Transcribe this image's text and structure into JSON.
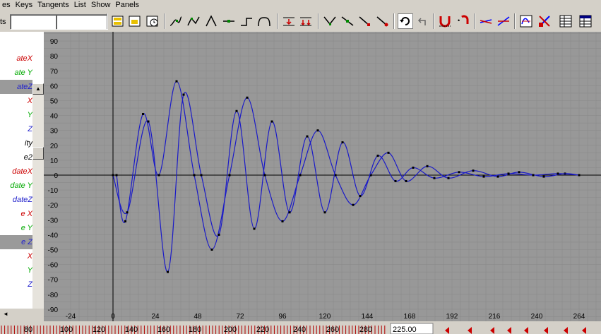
{
  "menu": [
    "es",
    "Keys",
    "Tangents",
    "List",
    "Show",
    "Panels"
  ],
  "toolbar": {
    "stats_label": "ts",
    "field1_value": "",
    "field2_value": "",
    "buttons": [
      {
        "name": "frame-all-button",
        "icon": "frame-all-icon"
      },
      {
        "name": "frame-selection-button",
        "icon": "frame-selection-icon"
      },
      {
        "name": "frame-playback-button",
        "icon": "clock-icon"
      },
      {
        "name": "spline-tangents-button",
        "icon": "spline-tangent-icon"
      },
      {
        "name": "clamped-tangents-button",
        "icon": "clamped-tangent-icon"
      },
      {
        "name": "linear-tangents-button",
        "icon": "linear-tangent-icon"
      },
      {
        "name": "flat-tangents-button",
        "icon": "flat-tangent-icon"
      },
      {
        "name": "step-tangents-button",
        "icon": "step-tangent-icon"
      },
      {
        "name": "plateau-tangents-button",
        "icon": "plateau-tangent-icon"
      },
      {
        "name": "buffer-curve-snapshot-button",
        "icon": "buffer-snapshot-icon"
      },
      {
        "name": "buffer-curve-swap-button",
        "icon": "buffer-swap-icon"
      },
      {
        "name": "break-tangents-button",
        "icon": "break-tangent-icon"
      },
      {
        "name": "unify-tangents-button",
        "icon": "unify-tangent-icon"
      },
      {
        "name": "free-tangent-weight-button",
        "icon": "free-weight-icon"
      },
      {
        "name": "lock-tangent-weight-button",
        "icon": "lock-weight-icon"
      },
      {
        "name": "pre-infinity-cycle-button",
        "icon": "cycle-icon"
      },
      {
        "name": "post-infinity-button",
        "icon": "undo-arrow-icon"
      },
      {
        "name": "auto-load-button",
        "icon": "magnet-icon"
      },
      {
        "name": "load-from-selection-button",
        "icon": "magnet-load-icon"
      },
      {
        "name": "normalize-curve-button",
        "icon": "normalize-icon"
      },
      {
        "name": "denormalize-curve-button",
        "icon": "denormalize-icon"
      },
      {
        "name": "open-dope-sheet-button",
        "icon": "dope-sheet-icon"
      },
      {
        "name": "open-trax-editor-button",
        "icon": "trax-editor-icon"
      },
      {
        "name": "open-channel-box-button",
        "icon": "channel-table-icon"
      },
      {
        "name": "open-spreadsheet-button",
        "icon": "spreadsheet-icon"
      }
    ]
  },
  "outliner": {
    "rows": [
      {
        "label": "ateX",
        "color": "#cc0000",
        "selected": false
      },
      {
        "label": "ate Y",
        "color": "#00aa00",
        "selected": false
      },
      {
        "label": "ateZ",
        "color": "#2222cc",
        "selected": true
      },
      {
        "label": "X",
        "color": "#cc0000",
        "selected": false
      },
      {
        "label": "Y",
        "color": "#00aa00",
        "selected": false
      },
      {
        "label": "Z",
        "color": "#2222cc",
        "selected": false
      },
      {
        "label": "ity",
        "color": "#000000",
        "selected": false
      },
      {
        "label": "e2",
        "color": "#000000",
        "selected": false
      },
      {
        "label": "dateX",
        "color": "#cc0000",
        "selected": false
      },
      {
        "label": "date Y",
        "color": "#00aa00",
        "selected": false
      },
      {
        "label": "dateZ",
        "color": "#2222cc",
        "selected": false
      },
      {
        "label": "e X",
        "color": "#cc0000",
        "selected": false
      },
      {
        "label": "e Y",
        "color": "#00aa00",
        "selected": false
      },
      {
        "label": "e Z",
        "color": "#2222cc",
        "selected": true
      },
      {
        "label": "X",
        "color": "#cc0000",
        "selected": false
      },
      {
        "label": "Y",
        "color": "#00aa00",
        "selected": false
      },
      {
        "label": "Z",
        "color": "#2222cc",
        "selected": false
      }
    ]
  },
  "graph": {
    "x_ticks": [
      "-24",
      "0",
      "24",
      "48",
      "72",
      "96",
      "120",
      "144",
      "168",
      "192",
      "216",
      "240",
      "264"
    ],
    "y_ticks": [
      "90",
      "80",
      "70",
      "60",
      "50",
      "40",
      "30",
      "20",
      "10",
      "0",
      "-10",
      "-20",
      "-30",
      "-40",
      "-50",
      "-60",
      "-70",
      "-80",
      "-90"
    ],
    "colors": {
      "background": "#989898",
      "grid": "#8a8a8a",
      "axis": "#000000",
      "curve": "#1a1ac8",
      "key": "#000000"
    },
    "curves": [
      {
        "name": "curve-a",
        "keys": [
          [
            2,
            0
          ],
          [
            7,
            -31
          ],
          [
            17,
            41
          ],
          [
            26,
            0
          ],
          [
            36,
            63
          ],
          [
            46,
            0
          ],
          [
            56,
            -50
          ],
          [
            66,
            0
          ],
          [
            76,
            52
          ],
          [
            86,
            0
          ],
          [
            96,
            -31
          ],
          [
            106,
            0
          ],
          [
            116,
            30
          ],
          [
            126,
            0
          ],
          [
            136,
            -20
          ],
          [
            146,
            0
          ],
          [
            156,
            15
          ],
          [
            166,
            -4
          ],
          [
            178,
            6
          ],
          [
            190,
            -2
          ],
          [
            204,
            3
          ],
          [
            218,
            -1
          ],
          [
            230,
            2
          ],
          [
            244,
            -1
          ],
          [
            256,
            1
          ],
          [
            264,
            0
          ]
        ]
      },
      {
        "name": "curve-b",
        "keys": [
          [
            0,
            0
          ],
          [
            8,
            -25
          ],
          [
            20,
            36
          ],
          [
            31,
            -65
          ],
          [
            40,
            54
          ],
          [
            50,
            0
          ],
          [
            60,
            -40
          ],
          [
            70,
            43
          ],
          [
            80,
            -36
          ],
          [
            90,
            36
          ],
          [
            100,
            -25
          ],
          [
            110,
            26
          ],
          [
            120,
            -25
          ],
          [
            130,
            22
          ],
          [
            140,
            -14
          ],
          [
            150,
            13
          ],
          [
            160,
            -4
          ],
          [
            170,
            5
          ],
          [
            182,
            -2
          ],
          [
            196,
            2
          ],
          [
            210,
            -1
          ],
          [
            224,
            1
          ],
          [
            238,
            0
          ],
          [
            252,
            1
          ],
          [
            264,
            0
          ]
        ]
      }
    ]
  },
  "timeline": {
    "ticks": [
      "80",
      "100",
      "120",
      "140",
      "160",
      "180",
      "200",
      "220",
      "240",
      "260",
      "280"
    ],
    "current_frame": "225.00"
  }
}
